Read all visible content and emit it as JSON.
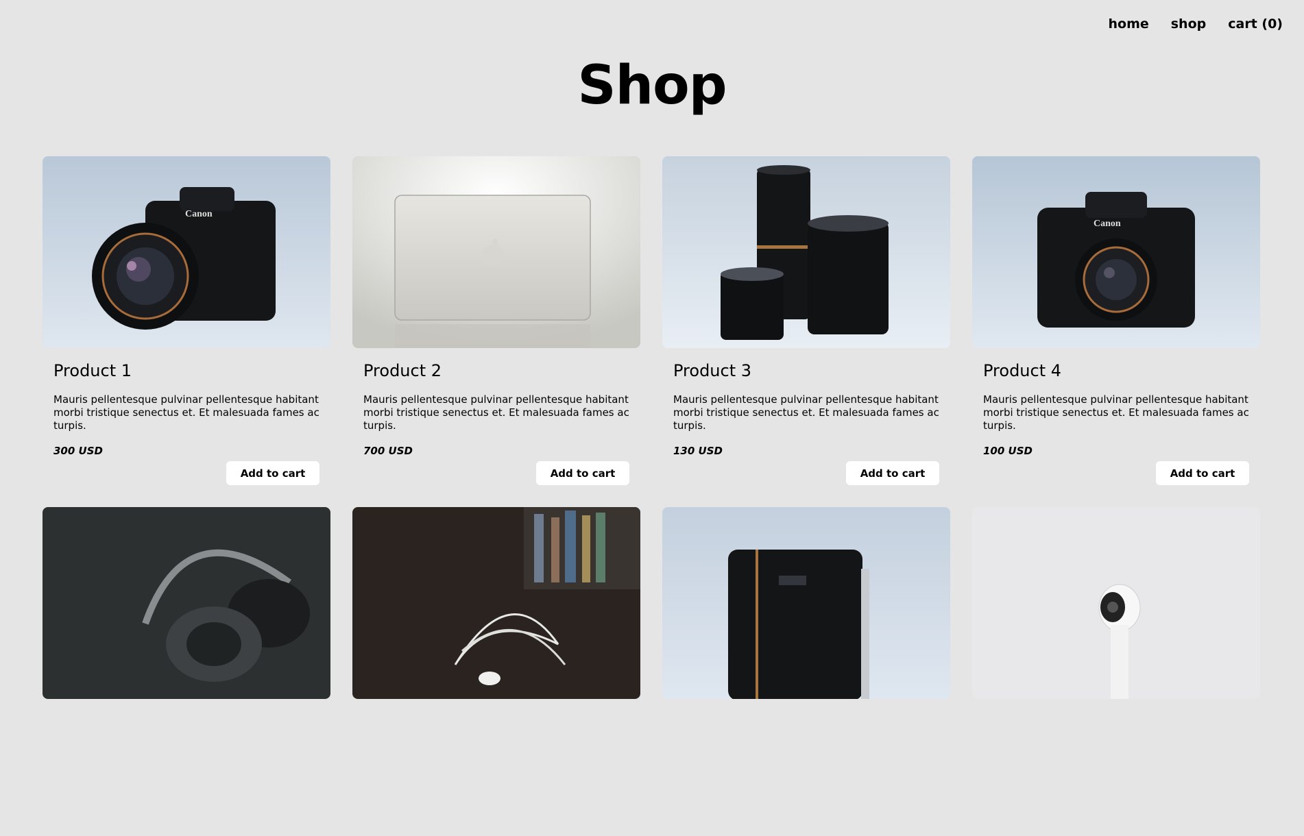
{
  "nav": {
    "home": "home",
    "shop": "shop",
    "cart": "cart (0)"
  },
  "page": {
    "title": "Shop"
  },
  "products": [
    {
      "name": "Product 1",
      "description": "Mauris pellentesque pulvinar pellentesque habitant morbi tristique senectus et. Et malesuada fames ac turpis.",
      "price": "300 USD",
      "button": "Add to cart",
      "image": "dslr-camera-with-zoom-lens"
    },
    {
      "name": "Product 2",
      "description": "Mauris pellentesque pulvinar pellentesque habitant morbi tristique senectus et. Et malesuada fames ac turpis.",
      "price": "700 USD",
      "button": "Add to cart",
      "image": "silver-laptop-lid"
    },
    {
      "name": "Product 3",
      "description": "Mauris pellentesque pulvinar pellentesque habitant morbi tristique senectus et. Et malesuada fames ac turpis.",
      "price": "130 USD",
      "button": "Add to cart",
      "image": "camera-lenses-set"
    },
    {
      "name": "Product 4",
      "description": "Mauris pellentesque pulvinar pellentesque habitant morbi tristique senectus et. Et malesuada fames ac turpis.",
      "price": "100 USD",
      "button": "Add to cart",
      "image": "dslr-camera-with-prime-lens"
    },
    {
      "image": "headphones"
    },
    {
      "image": "white-earphones"
    },
    {
      "image": "camera-lens"
    },
    {
      "image": "white-security-camera"
    }
  ]
}
